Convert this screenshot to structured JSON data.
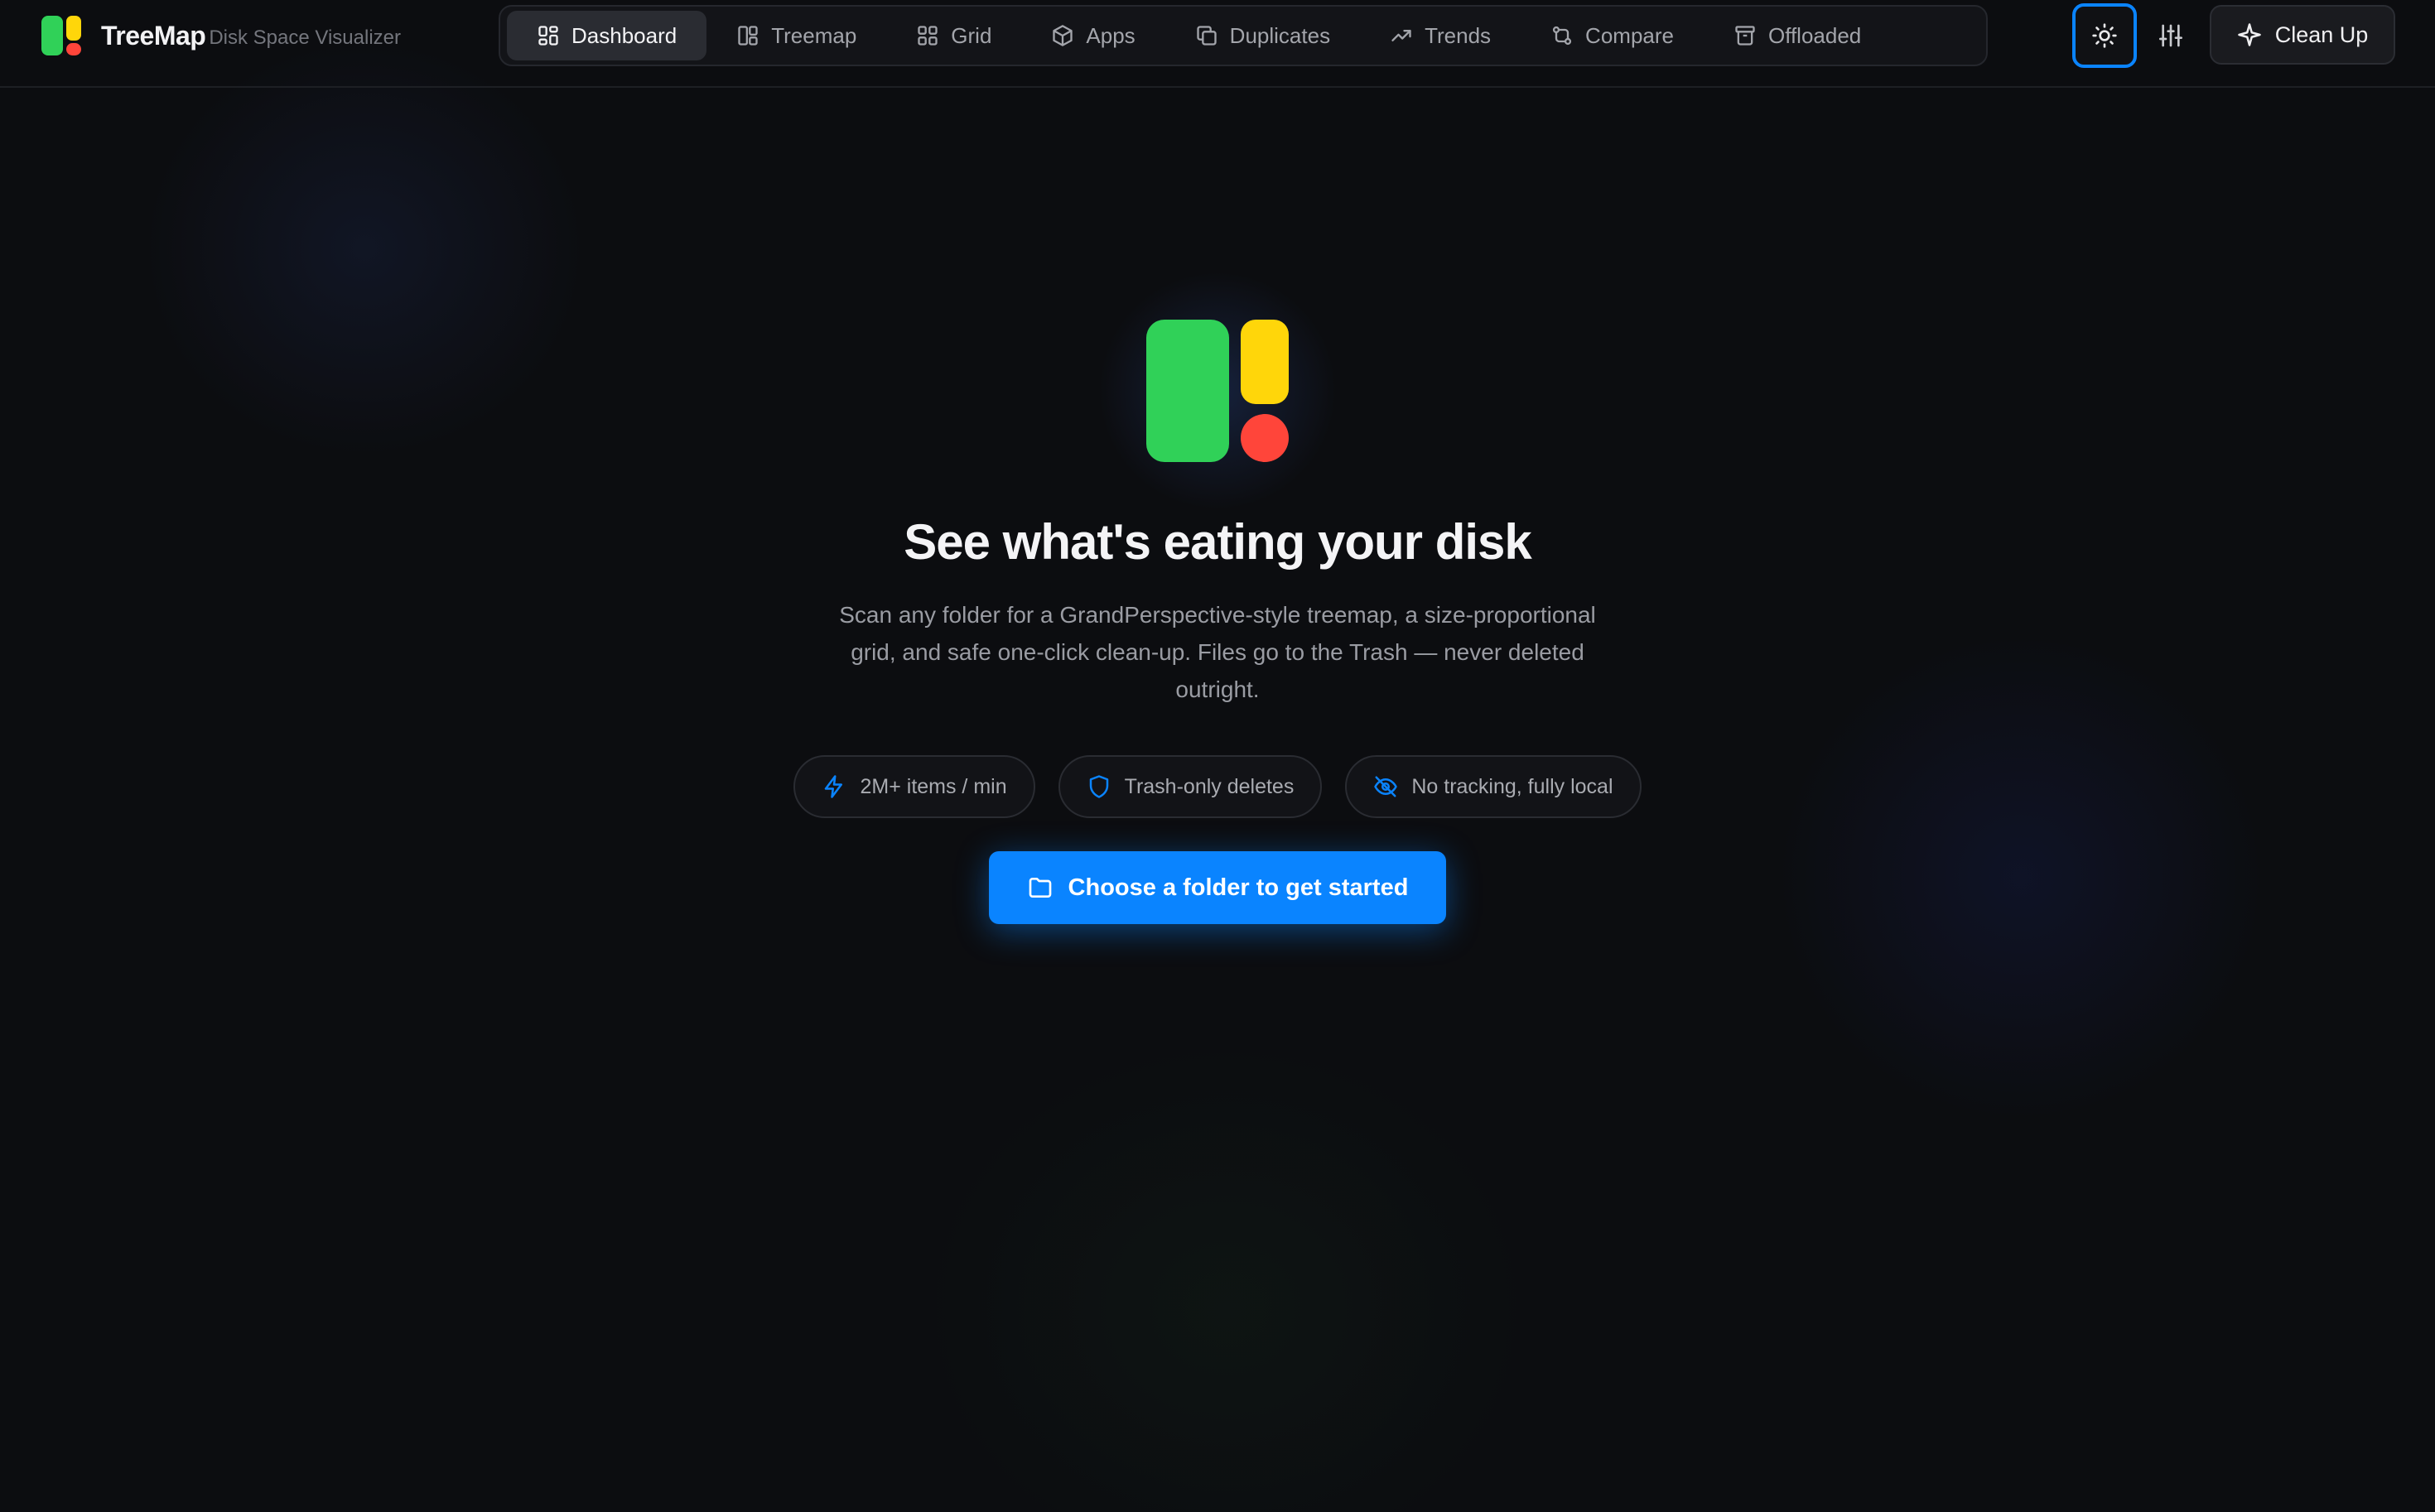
{
  "app": {
    "name": "TreeMap",
    "subtitle": "Disk Space Visualizer"
  },
  "nav": {
    "tabs": [
      {
        "label": "Dashboard",
        "icon": "dashboard-icon",
        "active": true
      },
      {
        "label": "Treemap",
        "icon": "treemap-icon",
        "active": false
      },
      {
        "label": "Grid",
        "icon": "grid-icon",
        "active": false
      },
      {
        "label": "Apps",
        "icon": "box-icon",
        "active": false
      },
      {
        "label": "Duplicates",
        "icon": "copy-icon",
        "active": false
      },
      {
        "label": "Trends",
        "icon": "trending-up-icon",
        "active": false
      },
      {
        "label": "Compare",
        "icon": "compare-icon",
        "active": false
      },
      {
        "label": "Offloaded",
        "icon": "archive-icon",
        "active": false
      }
    ]
  },
  "toolbar": {
    "theme_icon": "sun-icon",
    "settings_icon": "sliders-icon",
    "cleanup_label": "Clean Up",
    "cleanup_icon": "sparkle-icon"
  },
  "hero": {
    "title": "See what's eating your disk",
    "description": "Scan any folder for a GrandPerspective-style treemap, a size-proportional grid, and safe one-click clean-up. Files go to the Trash — never deleted outright.",
    "features": [
      {
        "label": "2M+ items / min",
        "icon": "bolt-icon"
      },
      {
        "label": "Trash-only deletes",
        "icon": "shield-icon"
      },
      {
        "label": "No tracking, fully local",
        "icon": "eye-off-icon"
      }
    ],
    "cta_label": "Choose a folder to get started",
    "cta_icon": "folder-icon"
  },
  "colors": {
    "accent": "#0a84ff",
    "logo_green": "#30d158",
    "logo_yellow": "#ffd60a",
    "logo_red": "#ff453a",
    "background": "#0c0d10"
  }
}
